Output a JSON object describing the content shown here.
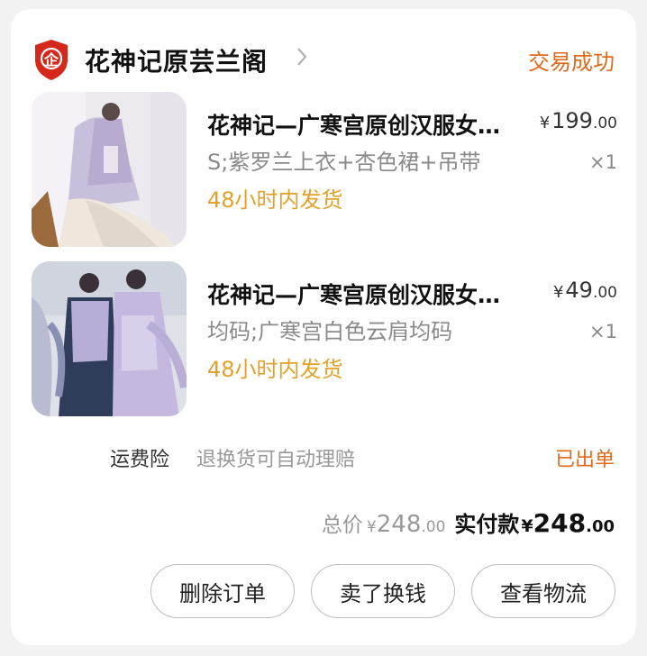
{
  "store": {
    "name": "花神记原芸兰阁",
    "badge_icon": "enterprise-shield-icon",
    "badge_text": "企",
    "status": "交易成功",
    "accent_color": "#e26a1b"
  },
  "items": [
    {
      "title": "花神记—广寒宫原创汉服女明制长袄",
      "spec": "S;紫罗兰上衣+杏色裙+吊带",
      "shipping": "48小时内发货",
      "price_symbol": "¥",
      "price_int": "199",
      "price_dec": ".00",
      "qty": "×1"
    },
    {
      "title": "花神记—广寒宫原创汉服女明制云肩",
      "spec": "均码;广寒宫白色云肩均码",
      "shipping": "48小时内发货",
      "price_symbol": "¥",
      "price_int": "49",
      "price_dec": ".00",
      "qty": "×1"
    }
  ],
  "insurance": {
    "label": "运费险",
    "desc": "退换货可自动理赔",
    "status": "已出单"
  },
  "totals": {
    "total_label": "总价",
    "total_symbol": "¥",
    "total_int": "248",
    "total_dec": ".00",
    "paid_label": "实付款",
    "paid_symbol": "¥",
    "paid_int": "248",
    "paid_dec": ".00"
  },
  "actions": {
    "delete_label": "删除订单",
    "resell_label": "卖了换钱",
    "logistics_label": "查看物流"
  }
}
